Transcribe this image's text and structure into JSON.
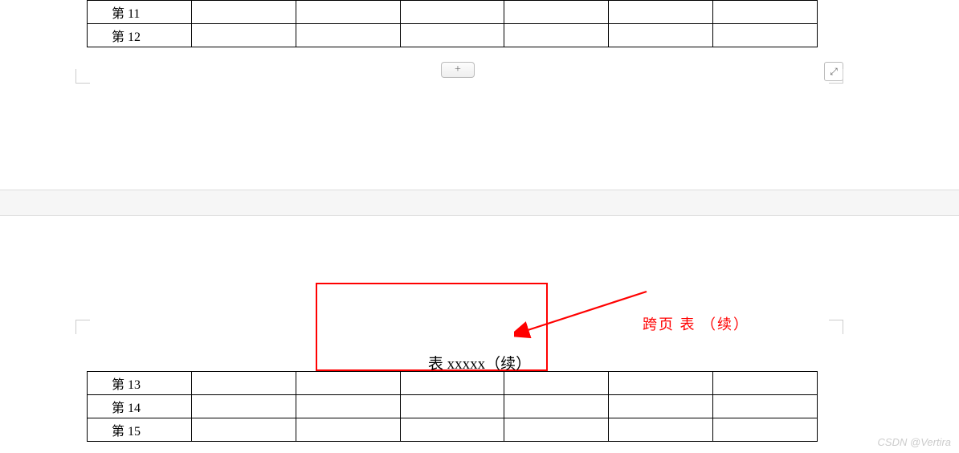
{
  "page1": {
    "rows": [
      {
        "label": "第 11"
      },
      {
        "label": "第 12"
      }
    ],
    "add_button": "+",
    "resize_glyph": "⤢"
  },
  "page2": {
    "caption": "表 xxxxx（续）",
    "annotation": "跨页 表 （续）",
    "rows": [
      {
        "label": "第 13"
      },
      {
        "label": "第 14"
      },
      {
        "label": "第 15"
      }
    ]
  },
  "watermark": "CSDN @Vertira"
}
